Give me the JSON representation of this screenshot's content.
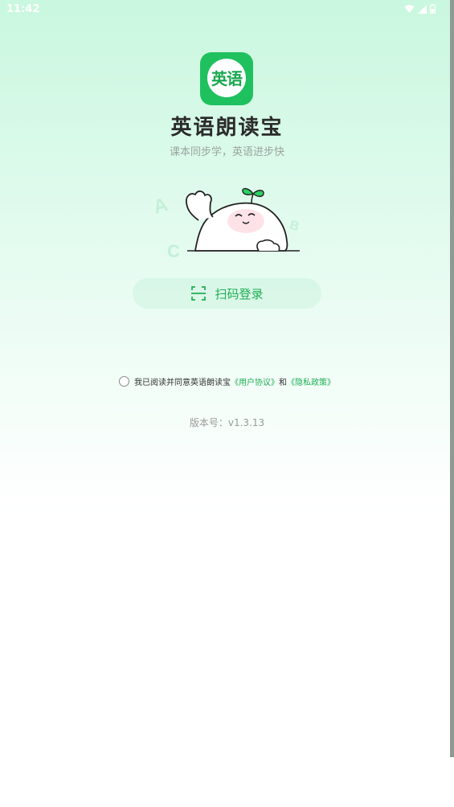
{
  "status_bar": {
    "time": "11:42"
  },
  "app": {
    "logo_text": "英语",
    "name": "英语朗读宝",
    "slogan": "课本同步学，英语进步快"
  },
  "mascot": {
    "letters": [
      "A",
      "B",
      "C"
    ]
  },
  "login": {
    "qr_label": "扫码登录"
  },
  "agreement": {
    "prefix": "我已阅读并同意英语朗读宝",
    "user_agreement": "《用户协议》",
    "conjunction": "和",
    "privacy_policy": "《隐私政策》",
    "checked": false
  },
  "version": {
    "text": "版本号：v1.3.13"
  },
  "colors": {
    "brand_green": "#1fc15f",
    "link_green": "#1fae54",
    "background_top": "#c9f7df",
    "background_bottom": "#ffffff"
  },
  "icons": [
    "wifi-icon",
    "cellular-signal-icon",
    "battery-icon",
    "scan-icon",
    "radio-unchecked-icon"
  ]
}
